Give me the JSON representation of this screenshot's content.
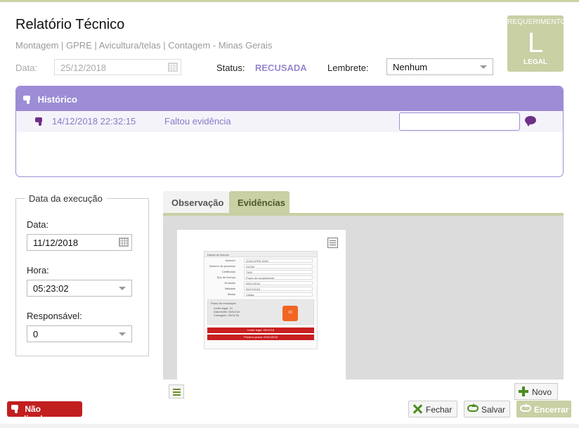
{
  "page": {
    "title": "Relatório Técnico",
    "subtitle": "Montagem | GPRE | Avicultura/telas | Contagem - Minas Gerais"
  },
  "badge": {
    "top": "REQUERIMENTO",
    "letter": "L",
    "bottom": "LEGAL"
  },
  "header": {
    "date_label": "Data:",
    "date_value": "25/12/2018",
    "status_label": "Status:",
    "status_value": "RECUSADA",
    "reminder_label": "Lembrete:",
    "reminder_value": "Nenhum"
  },
  "historico": {
    "title": "Histórico",
    "entries": [
      {
        "datetime": "14/12/2018 22:32:15",
        "text": "Faltou evidência",
        "reply_placeholder": ""
      }
    ]
  },
  "execucao": {
    "legend": "Data da execução",
    "date_label": "Data:",
    "date_value": "11/12/2018",
    "time_label": "Hora:",
    "time_value": "05:23:02",
    "resp_label": "Responsável:",
    "resp_value": "0"
  },
  "tabs": [
    {
      "label": "Observação",
      "active": false
    },
    {
      "label": "Evidências",
      "active": true
    }
  ],
  "evidence_preview": {
    "header": "Dados do licença",
    "rows": [
      {
        "k": "Número",
        "v": "2018-GPRE-0090"
      },
      {
        "k": "Número do processo",
        "v": "24/340"
      },
      {
        "k": "Certificado",
        "v": "7400"
      },
      {
        "k": "Tipo de licença",
        "v": "Prazo de cumprimento"
      },
      {
        "k": "Emissão",
        "v": "05/11/2018"
      },
      {
        "k": "Validade",
        "v": "05/12/2018"
      },
      {
        "k": "Status",
        "v": "Válida"
      }
    ],
    "box_title": "Prazo de renovação",
    "box_lines": [
      "Limite legal: 10",
      "Data limite: 05/12/18",
      "Contagem: 05/11/18"
    ],
    "box_number": "10",
    "red_bars": [
      "Limite legal: 05/12/18",
      "Próximo prazo: 09/11/2018"
    ]
  },
  "panel_buttons": {
    "novo": "Novo"
  },
  "footer": {
    "nao_realizado": "Não realizado",
    "fechar": "Fechar",
    "salvar": "Salvar",
    "encerrar": "Encerrar"
  },
  "colors": {
    "accent_purple": "#9d8cd6",
    "accent_green": "#c8d0a4",
    "danger_red": "#c21f1f",
    "icon_green": "#4b8b1e"
  }
}
